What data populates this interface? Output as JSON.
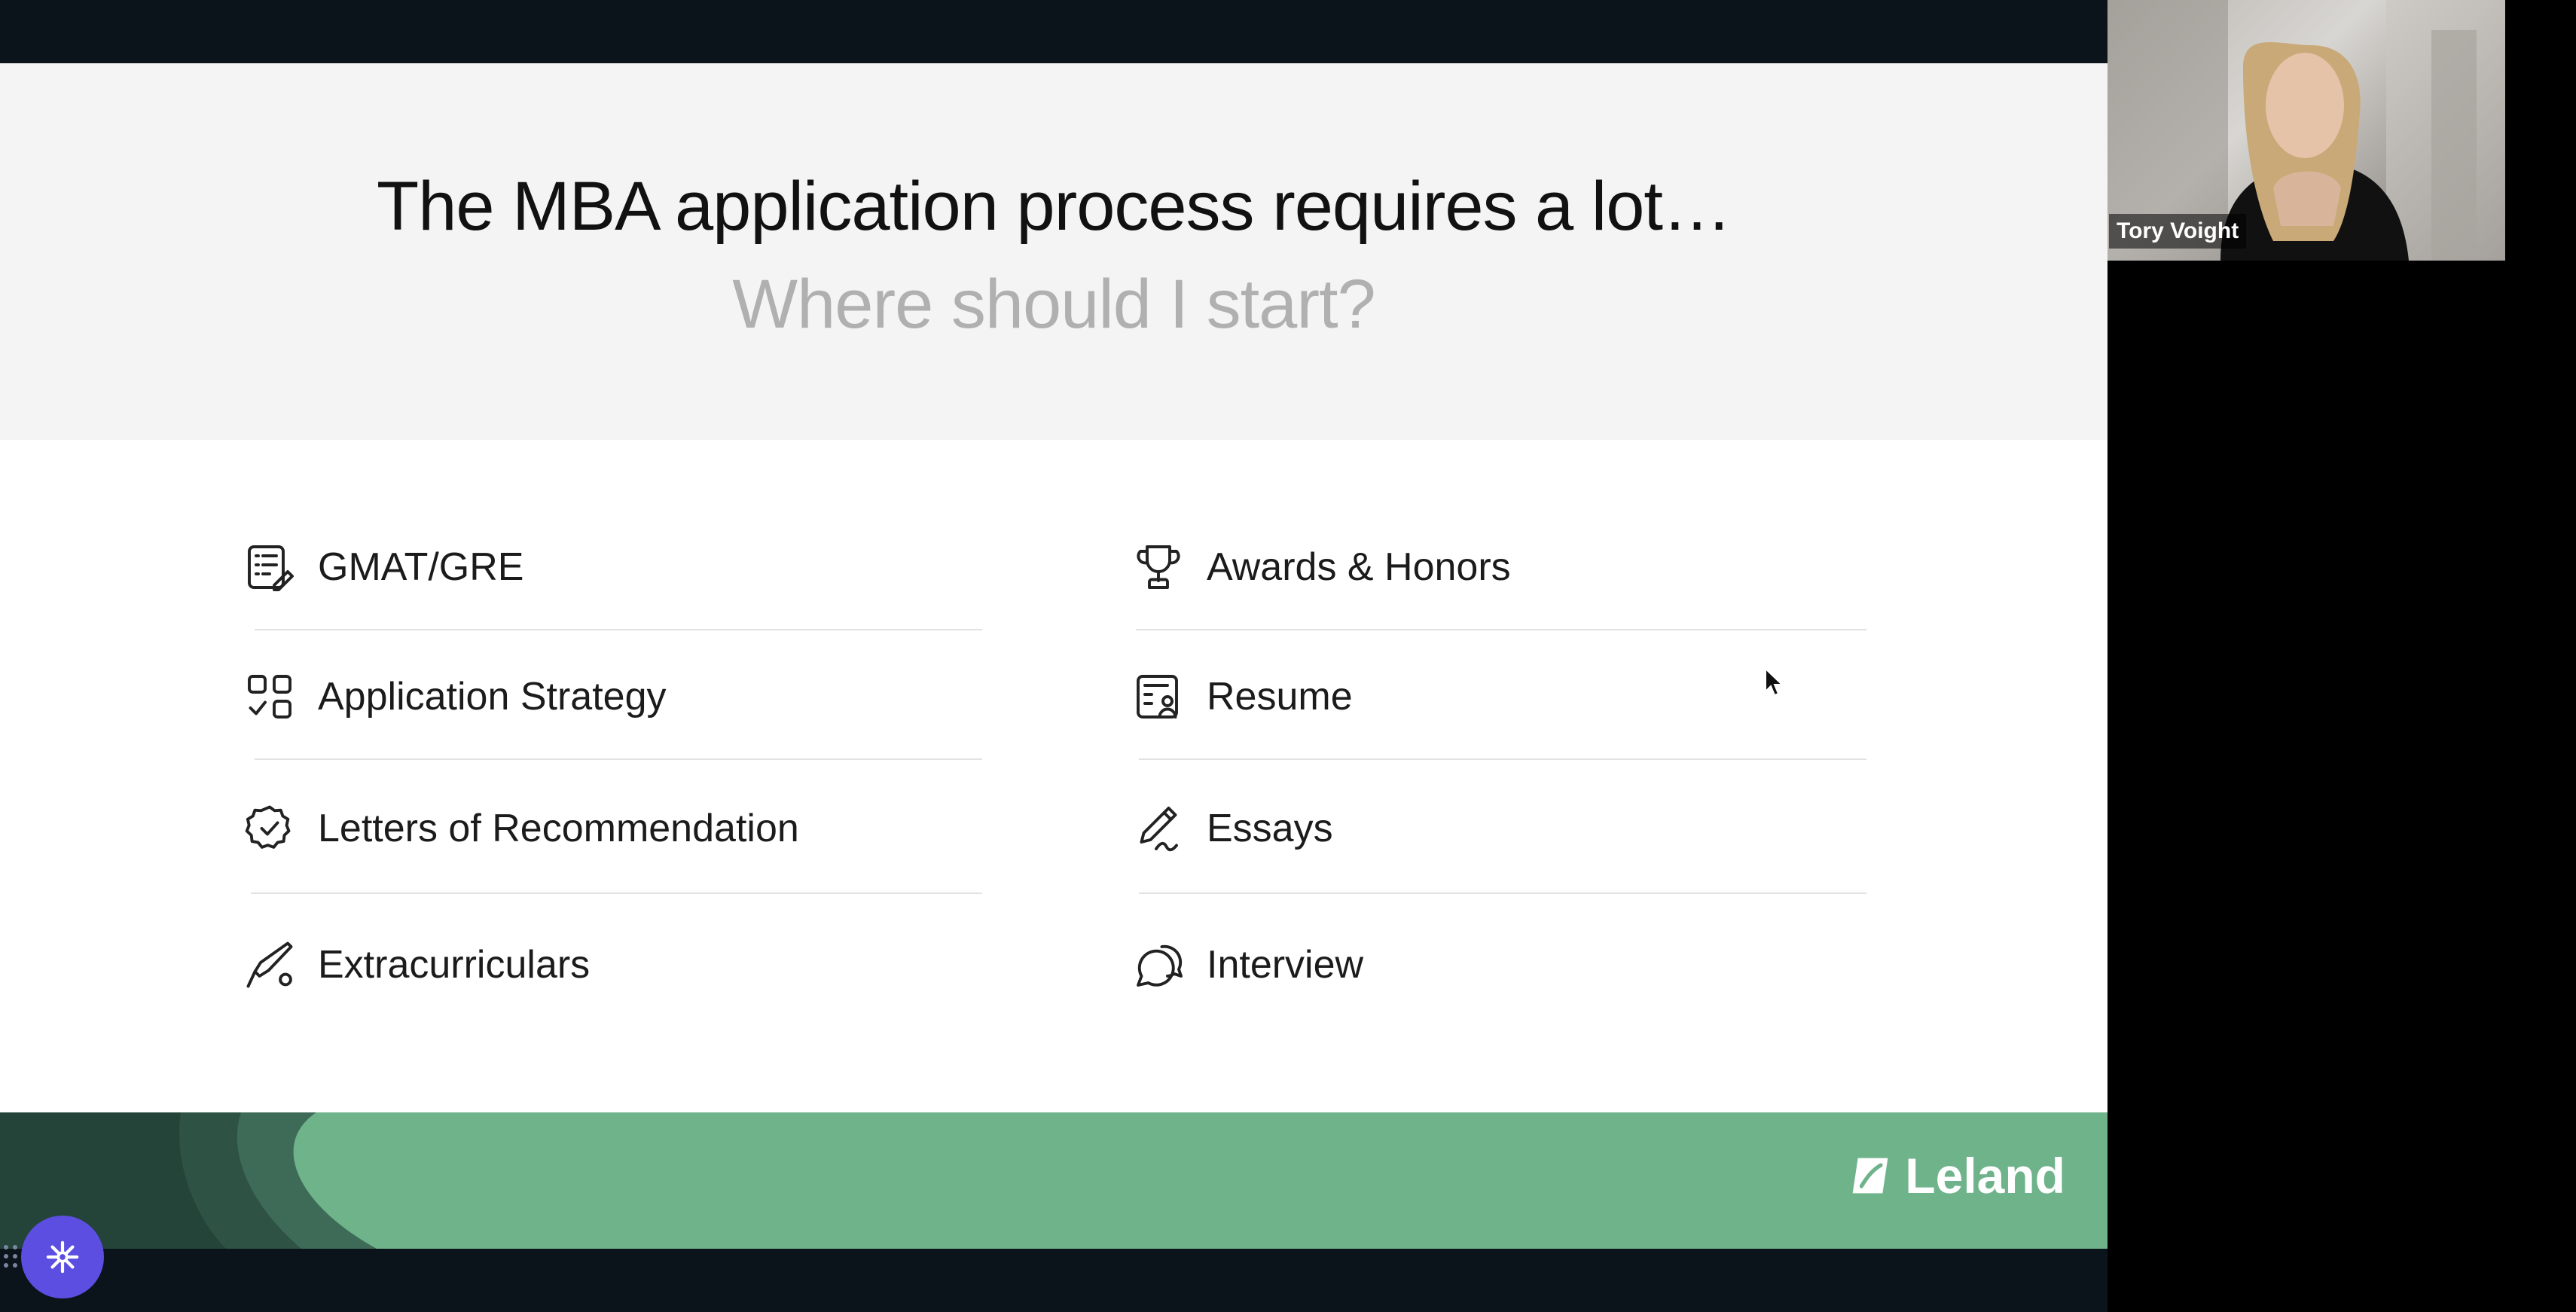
{
  "slide": {
    "title": "The MBA application process requires a lot…",
    "subtitle": "Where should I start?",
    "left_items": [
      {
        "label": "GMAT/GRE",
        "icon": "test-sheet-icon"
      },
      {
        "label": "Application Strategy",
        "icon": "strategy-grid-icon"
      },
      {
        "label": "Letters of Recommendation",
        "icon": "verified-badge-icon"
      },
      {
        "label": "Extracurriculars",
        "icon": "bat-ball-icon"
      }
    ],
    "right_items": [
      {
        "label": "Awards & Honors",
        "icon": "trophy-icon"
      },
      {
        "label": "Resume",
        "icon": "resume-icon"
      },
      {
        "label": "Essays",
        "icon": "pen-icon"
      },
      {
        "label": "Interview",
        "icon": "chat-bubbles-icon"
      }
    ],
    "brand": "Leland",
    "colors": {
      "footer_green": "#6fb38b",
      "footer_dark": "#2f4f42",
      "header_bg": "#f4f4f4",
      "subtitle_gray": "#b0b0b0"
    }
  },
  "participant": {
    "name": "Tory Voight"
  },
  "widget": {
    "icon": "snowflake-icon",
    "color": "#5b4ee0"
  }
}
